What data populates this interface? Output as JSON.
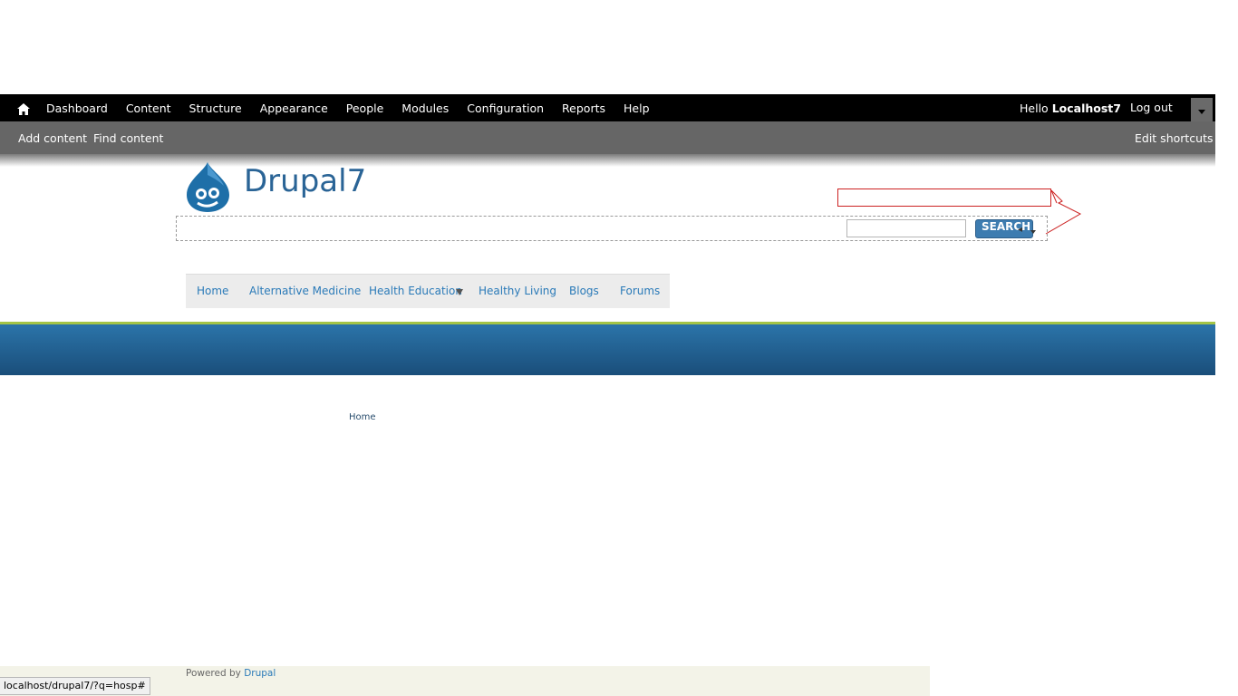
{
  "toolbar": {
    "home_icon": "home-icon",
    "items": [
      "Dashboard",
      "Content",
      "Structure",
      "Appearance",
      "People",
      "Modules",
      "Configuration",
      "Reports",
      "Help"
    ],
    "hello": "Hello",
    "username": "Localhost7",
    "logout": "Log out",
    "drawer_icon": "chevron-down-icon"
  },
  "shortcuts": {
    "add_content": "Add content",
    "find_content": "Find content",
    "edit_shortcuts": "Edit shortcuts"
  },
  "branding": {
    "site_name": "Drupal7",
    "logo_icon": "drupal-drop-logo"
  },
  "search": {
    "value": "",
    "button_label": "SEARCH"
  },
  "main_menu": {
    "items": [
      "Home",
      "Alternative Medicine",
      "Health Education",
      "Healthy Living",
      "Blogs",
      "Forums"
    ]
  },
  "breadcrumb": "Home",
  "footer": {
    "powered_by": "Powered by",
    "drupal_link": "Drupal"
  },
  "statusbar": "localhost/drupal7/?q=hosp#",
  "colors": {
    "toolbar_bg": "#000000",
    "shortcuts_bg": "#666666",
    "accent_blue": "#2b74a9",
    "link_blue": "#2a7ab8",
    "green_line": "#a3c446"
  }
}
